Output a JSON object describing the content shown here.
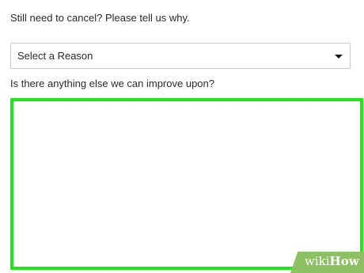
{
  "cancel_form": {
    "reason_question": "Still need to cancel? Please tell us why.",
    "reason_select": {
      "selected_value": "Select a Reason",
      "icon": "caret-down-icon"
    },
    "improve_question": "Is there anything else we can improve upon?",
    "feedback_input": {
      "value": "",
      "placeholder": ""
    }
  },
  "watermark": {
    "prefix": "wiki",
    "suffix": "How"
  },
  "colors": {
    "highlight_border": "#22e61b",
    "watermark_background": "#8cc062"
  }
}
